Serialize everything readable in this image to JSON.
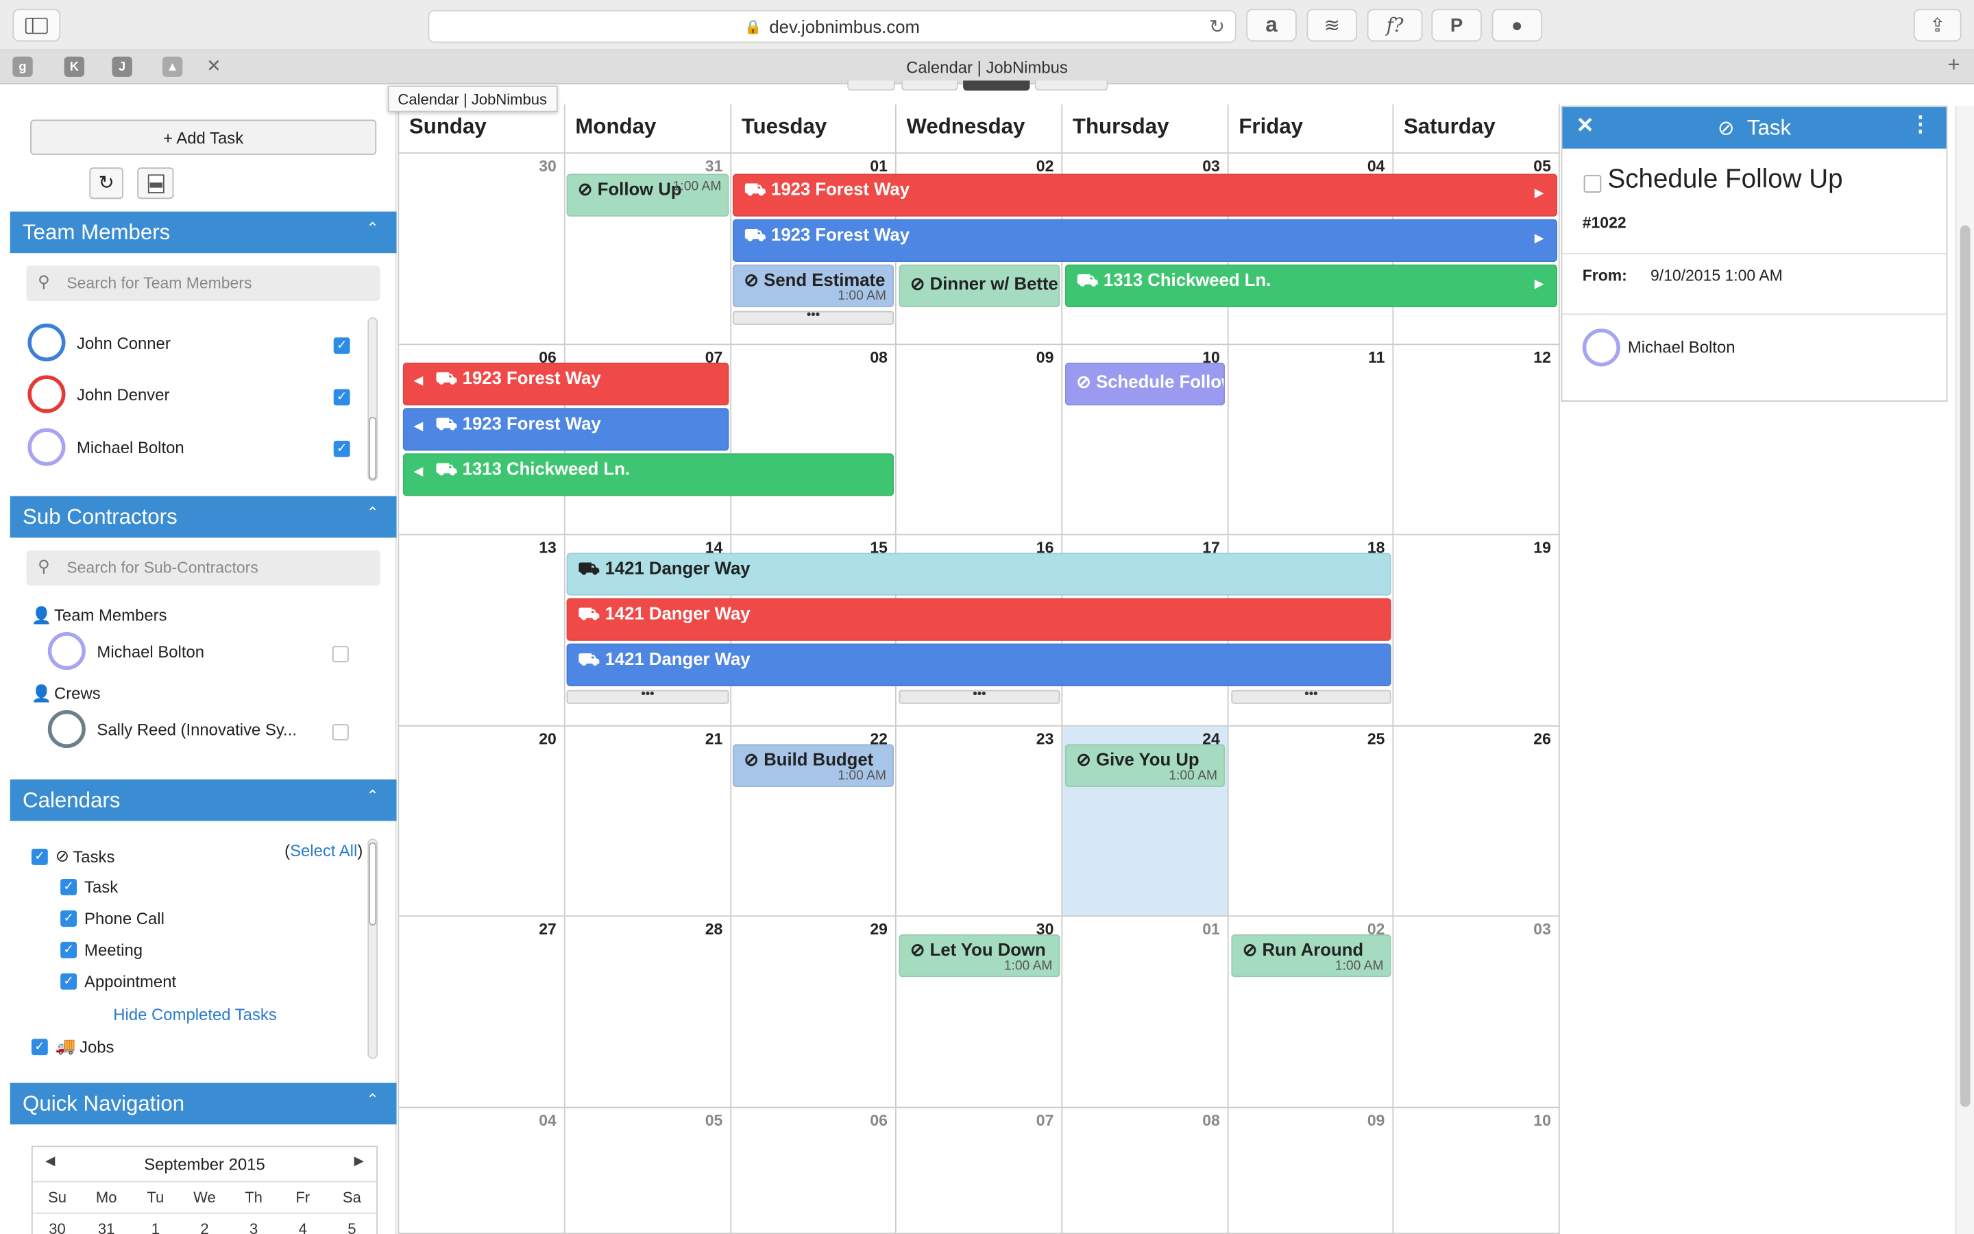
{
  "browser": {
    "url": "dev.jobnimbus.com",
    "tab_title": "Calendar | JobNimbus",
    "tooltip": "Calendar | JobNimbus",
    "pinned_tabs": [
      "K",
      "J"
    ]
  },
  "sidebar": {
    "add_task_label": "+ Add Task",
    "team_members": {
      "title": "Team Members",
      "search_placeholder": "Search for Team Members",
      "members": [
        {
          "name": "John Conner",
          "color": "#3a80d9",
          "checked": true
        },
        {
          "name": "John Denver",
          "color": "#e53935",
          "checked": true
        },
        {
          "name": "Michael Bolton",
          "color": "#a7a4f2",
          "checked": true
        }
      ]
    },
    "sub_contractors": {
      "title": "Sub Contractors",
      "search_placeholder": "Search for Sub-Contractors",
      "group_team": "Team Members",
      "team_member": "Michael Bolton",
      "group_crews": "Crews",
      "crew": "Sally Reed (Innovative Sy..."
    },
    "calendars": {
      "title": "Calendars",
      "tasks_label": "Tasks",
      "select_all_open": "(",
      "select_all": "Select All",
      "select_all_close": ")",
      "task_types": [
        "Task",
        "Phone Call",
        "Meeting",
        "Appointment"
      ],
      "hide_completed": "Hide Completed Tasks",
      "jobs_label": "Jobs"
    },
    "quick_nav": {
      "title": "Quick Navigation",
      "month": "September 2015",
      "weekdays": [
        "Su",
        "Mo",
        "Tu",
        "We",
        "Th",
        "Fr",
        "Sa"
      ],
      "first_week": [
        "30",
        "31",
        "1",
        "2",
        "3",
        "4",
        "5"
      ]
    }
  },
  "calendar": {
    "weekdays": [
      "Sunday",
      "Monday",
      "Tuesday",
      "Wednesday",
      "Thursday",
      "Friday",
      "Saturday"
    ],
    "weeks": [
      [
        "30",
        "31",
        "01",
        "02",
        "03",
        "04",
        "05"
      ],
      [
        "06",
        "07",
        "08",
        "09",
        "10",
        "11",
        "12"
      ],
      [
        "13",
        "14",
        "15",
        "16",
        "17",
        "18",
        "19"
      ],
      [
        "20",
        "21",
        "22",
        "23",
        "24",
        "25",
        "26"
      ],
      [
        "27",
        "28",
        "29",
        "30",
        "01",
        "02",
        "03"
      ],
      [
        "04",
        "05",
        "06",
        "07",
        "08",
        "09",
        "10"
      ]
    ],
    "events": {
      "follow_up": {
        "title": "Follow Up",
        "time": "1:00 AM"
      },
      "forest1": "1923 Forest Way",
      "forest2": "1923 Forest Way",
      "send_estimate": {
        "title": "Send Estimate",
        "time": "1:00 AM"
      },
      "dinner": "Dinner w/ Better Half",
      "chickweed": "1313 Chickweed Ln.",
      "forest1b": "1923 Forest Way",
      "forest2b": "1923 Forest Way",
      "chickweed_b": "1313 Chickweed Ln.",
      "schedule_follow": "Schedule Follow Up",
      "danger1": "1421 Danger Way",
      "danger2": "1421 Danger Way",
      "danger3": "1421 Danger Way",
      "build_budget": {
        "title": "Build Budget",
        "time": "1:00 AM"
      },
      "give_you_up": {
        "title": "Give You Up",
        "time": "1:00 AM"
      },
      "let_you_down": {
        "title": "Let You Down",
        "time": "1:00 AM"
      },
      "run_around": {
        "title": "Run Around",
        "time": "1:00 AM"
      },
      "more": "•••"
    }
  },
  "task_panel": {
    "header": "Task",
    "title": "Schedule Follow Up",
    "number": "#1022",
    "from_label": "From:",
    "from_value": "9/10/2015 1:00 AM",
    "assignee": "Michael Bolton"
  }
}
